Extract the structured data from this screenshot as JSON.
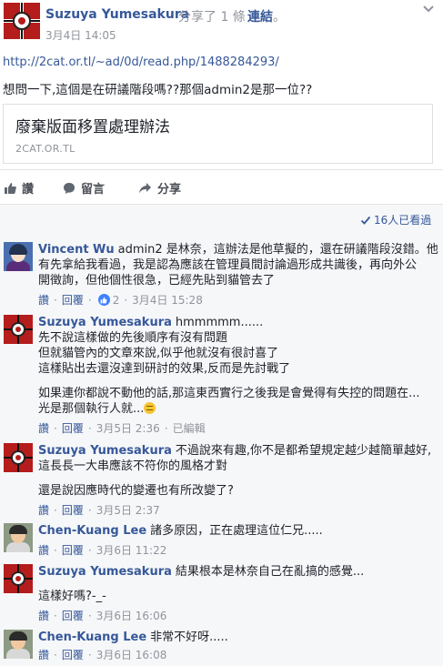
{
  "post": {
    "author": "Suzuya Yumesakura",
    "action": "分享了 1 條",
    "action_link": "連結",
    "action_end": "。",
    "time": "3月4日 14:05",
    "menu_icon": "chevron-down-icon",
    "url": "http://2cat.or.tl/~ad/0d/read.php/1488284293/",
    "text": "想問一下,這個是在研議階段嗎??那個admin2是那一位??",
    "link_card": {
      "title": "廢棄版面移置處理辦法",
      "domain": "2CAT.OR.TL"
    }
  },
  "actions": {
    "like": "讚",
    "comment": "留言",
    "share": "分享"
  },
  "seen": "16人已看過",
  "comments": [
    {
      "author": "Vincent Wu",
      "lines": [
        "admin2 是林奈，這辦法是他草擬的，還在研議階段沒錯。他",
        "有先拿給我看過，我是認為應該在管理員間討論過形成共識後，再向外公",
        "開徵詢，但他個性很急，已經先貼到貓管去了"
      ],
      "meta": {
        "like": "讚",
        "reply": "回覆",
        "likes": "2",
        "time": "3月4日 15:28"
      }
    },
    {
      "author": "Suzuya Yumesakura",
      "lines": [
        "hmmmmm......",
        "先不說這樣做的先後順序有沒有問題",
        "但就貓管內的文章來說,似乎他就沒有很討喜了",
        "這樣貼出去還沒達到研討的效果,反而是先討戰了",
        "",
        "如果連你都說不動他的話,那這東西實行之後我是會覺得有失控的問題在...",
        "光是那個執行人就..."
      ],
      "meta": {
        "like": "讚",
        "reply": "回覆",
        "time": "3月5日 2:36",
        "edited": "已編輯"
      }
    },
    {
      "author": "Suzuya Yumesakura",
      "lines": [
        "不過說來有趣,你不是都希望規定越少越簡單越好,",
        "這長長一大串應該不符你的風格才對",
        "",
        "還是說因應時代的變遷也有所改變了?"
      ],
      "meta": {
        "like": "讚",
        "reply": "回覆",
        "time": "3月5日 2:37"
      }
    },
    {
      "author": "Chen-Kuang Lee",
      "lines": [
        "諸多原因，正在處理這位仁兄....."
      ],
      "meta": {
        "like": "讚",
        "reply": "回覆",
        "time": "3月6日 11:22"
      }
    },
    {
      "author": "Suzuya Yumesakura",
      "lines": [
        "結果根本是林奈自己在亂搞的感覺...",
        "",
        "這樣好嗎?-_-"
      ],
      "meta": {
        "like": "讚",
        "reply": "回覆",
        "time": "3月6日 16:06"
      }
    },
    {
      "author": "Chen-Kuang Lee",
      "lines": [
        "非常不好呀....."
      ],
      "meta": {
        "like": "讚",
        "reply": "回覆",
        "time": "3月6日 16:08"
      }
    }
  ]
}
